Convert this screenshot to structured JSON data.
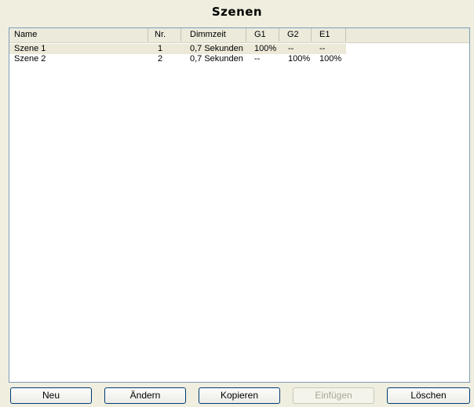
{
  "window": {
    "title": "Szenen"
  },
  "table": {
    "columns": [
      "Name",
      "Nr.",
      "Dimmzeit",
      "G1",
      "G2",
      "E1"
    ],
    "rows": [
      [
        "Szene 1",
        "1",
        "0,7 Sekunden",
        "100%",
        "--",
        "--"
      ],
      [
        "Szene 2",
        "2",
        "0,7 Sekunden",
        "--",
        "100%",
        "100%"
      ]
    ],
    "selected_row": 0
  },
  "buttons": {
    "new": "Neu",
    "edit": "Ändern",
    "copy": "Kopieren",
    "paste": "Einfügen",
    "delete": "Löschen"
  },
  "colors": {
    "background": "#efeedf",
    "header": "#ebeadb",
    "selected_row": "#ece9d8",
    "button_border": "#003c74"
  }
}
